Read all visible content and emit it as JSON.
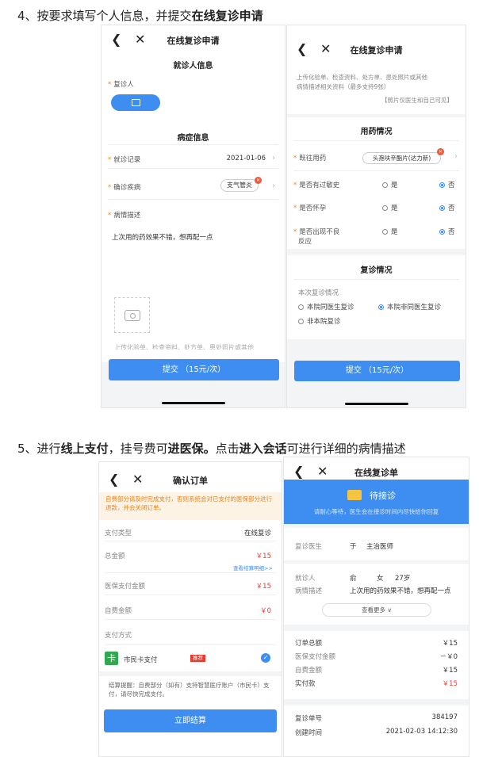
{
  "step4": {
    "number": "4、",
    "text": "按要求填写个人信息，并提交",
    "bold": "在线复诊申请"
  },
  "step5": {
    "number": "5、",
    "t1": "进行",
    "b1": "线上支付",
    "t2": "，挂号费可",
    "b2": "进医保。",
    "t3": "点击",
    "b3": "进入会话",
    "t4": "可进行详细的病情描述"
  },
  "phone1": {
    "title": "在线复诊申请",
    "patient_section": "就诊人信息",
    "patient_label": "复诊人",
    "illness_section": "病症信息",
    "visit_label": "就诊记录",
    "visit_value": "2021-01-06",
    "diagnosis_label": "确诊疾病",
    "diagnosis_value": "支气管炎",
    "desc_label": "病情描述",
    "desc_value": "上次用的药效果不错，想再配一点",
    "upload_hint": "上传化验单、检查资料、处方单、患处照片或其他",
    "submit": "提交 （15元/次）"
  },
  "phone2": {
    "title": "在线复诊申请",
    "upload_hint_1": "上传化验单、检查资料、处方单、患处照片或其他",
    "upload_hint_2": "病情描述相关资料（最多支持9张）",
    "privacy": "【照片仅医生和自己可见】",
    "drug_section": "用药情况",
    "used_drug_label": "既往用药",
    "used_drug_value": "头孢呋辛酯片(达力新)",
    "allergy_label": "是否有过敏史",
    "pregnant_label": "是否怀孕",
    "adverse_label_1": "是否出现不良",
    "adverse_label_2": "反应",
    "yes": "是",
    "no": "否",
    "revisit_section": "复诊情况",
    "revisit_label": "本次复诊情况",
    "opt1": "本院同医生复诊",
    "opt2": "本院非同医生复诊",
    "opt3": "非本院复诊",
    "submit": "提交 （15元/次）"
  },
  "phone3": {
    "title": "确认订单",
    "warning": "自费部分请及时完成支付，否则系统会对已支付的医保部分进行退款，并会关闭订单。",
    "pay_type_label": "支付类型",
    "pay_type_value": "在线复诊",
    "total_label": "总金额",
    "total_value": "￥15",
    "detail_link": "查看结算明细>>",
    "insurance_label": "医保支付金额",
    "insurance_value": "￥15",
    "self_label": "自费金额",
    "self_value": "￥0",
    "method_label": "支付方式",
    "card_label": "市民卡支付",
    "card_tag": "推荐",
    "tip": "结算提醒：自费部分（如有）支持智慧医疗账户（市民卡）支付，请尽快完成支付。",
    "pay_button": "立即结算"
  },
  "phone4": {
    "title": "在线复诊单",
    "status": "待接诊",
    "status_sub": "请耐心等待，医生会在接诊时间内尽快给你回复",
    "doctor_label": "复诊医生",
    "doctor_name": "于",
    "doctor_title": "主治医师",
    "patient_label": "就诊人",
    "patient_name": "俞",
    "patient_sex": "女",
    "patient_age": "27岁",
    "desc_label": "病情描述",
    "desc_value": "上次用的药效果不错，想再配一点",
    "more": "查看更多",
    "order_total_label": "订单总额",
    "order_total_value": "￥15",
    "ins_label": "医保支付金额",
    "ins_value": "－￥0",
    "self_label": "自费金额",
    "self_value": "￥15",
    "actual_label": "实付款",
    "actual_value": "￥15",
    "no_label": "复诊单号",
    "no_value": "384197",
    "time_label": "创建时间",
    "time_value": "2021-02-03 14:12:30"
  }
}
